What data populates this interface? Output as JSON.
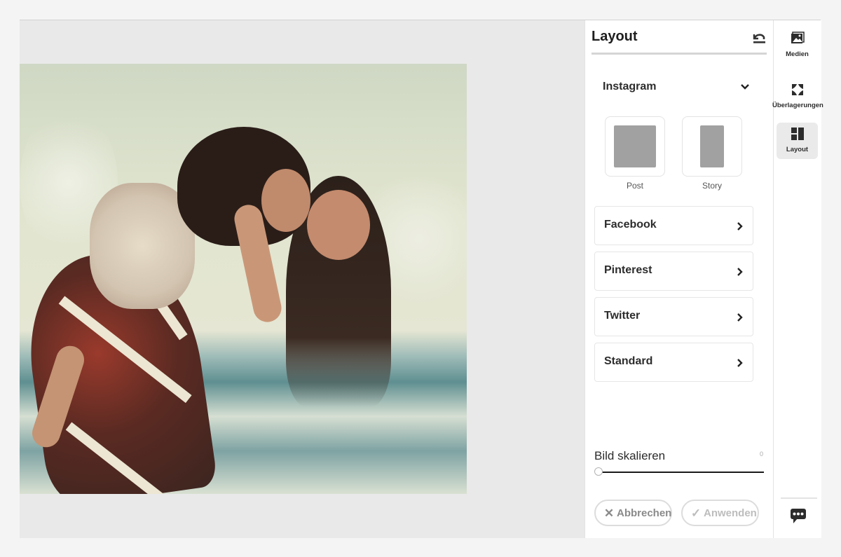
{
  "panel": {
    "title": "Layout",
    "reset_icon": "reset-undo-icon",
    "instagram": {
      "label": "Instagram",
      "expanded": true,
      "tiles": [
        {
          "label": "Post",
          "aspect": "1:1"
        },
        {
          "label": "Story",
          "aspect": "9:16"
        }
      ]
    },
    "platforms": [
      {
        "label": "Facebook"
      },
      {
        "label": "Pinterest"
      },
      {
        "label": "Twitter"
      },
      {
        "label": "Standard"
      }
    ],
    "scale": {
      "label": "Bild skalieren",
      "value": "0",
      "fraction": 0
    },
    "actions": {
      "cancel_label": "Abbrechen",
      "apply_label": "Anwenden"
    }
  },
  "rail": {
    "items": [
      {
        "label": "Medien",
        "icon": "image-icon",
        "active": false
      },
      {
        "label": "Überlagerungen",
        "icon": "overlay-frame-icon",
        "active": false
      },
      {
        "label": "Layout",
        "icon": "layout-icon",
        "active": true
      }
    ],
    "chat_icon": "chat-bubble-icon"
  },
  "canvas": {
    "image_description": "Mother carrying daughter on her back at the beach"
  },
  "colors": {
    "page_bg": "#f4f4f4",
    "canvas_bg": "#e9e9e9",
    "panel_bg": "#ffffff",
    "text": "#2c2c2c",
    "tile_fill": "#a1a1a1",
    "active_rail_bg": "#eaeaea"
  }
}
